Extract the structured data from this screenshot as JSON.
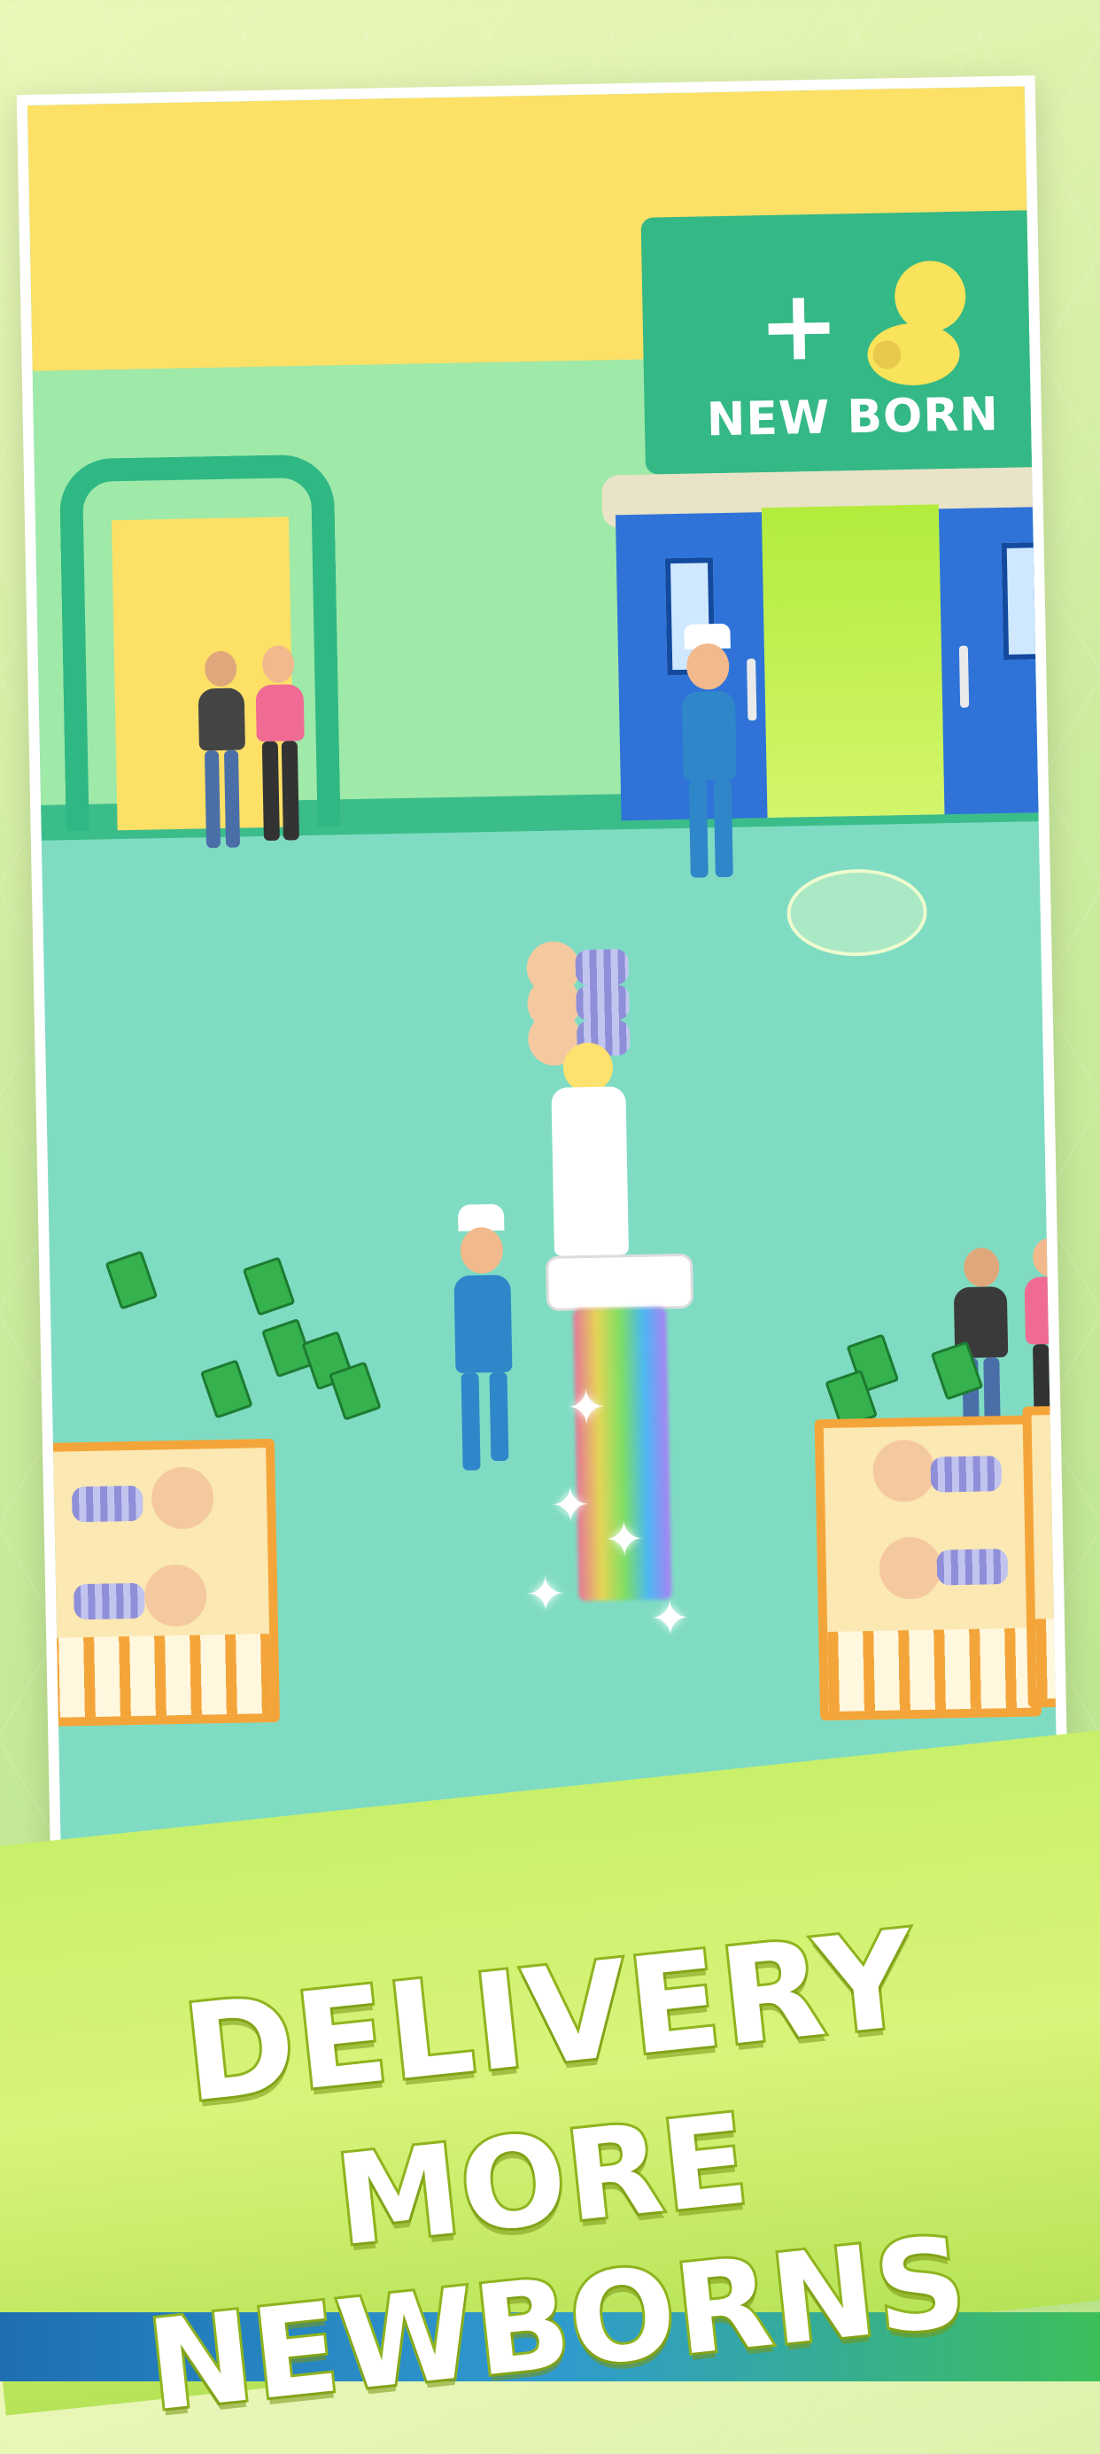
{
  "scene": {
    "sign_text": "NEW BORN",
    "sign_plus": "+"
  },
  "headline": {
    "line1": "DELIVERY",
    "line2": "MORE NEWBORNS"
  },
  "colors": {
    "wall_yellow": "#fde066",
    "wall_green": "#9fe9a9",
    "floor_teal": "#7fdcc3",
    "sign_green": "#34b886",
    "door_blue": "#2f73d8",
    "crib_orange": "#f4a53a",
    "banner_lime": "#d9f47a"
  },
  "icons": [
    "plus-icon",
    "baby-silhouette-icon",
    "money-stack-icon",
    "sparkle-icon"
  ]
}
